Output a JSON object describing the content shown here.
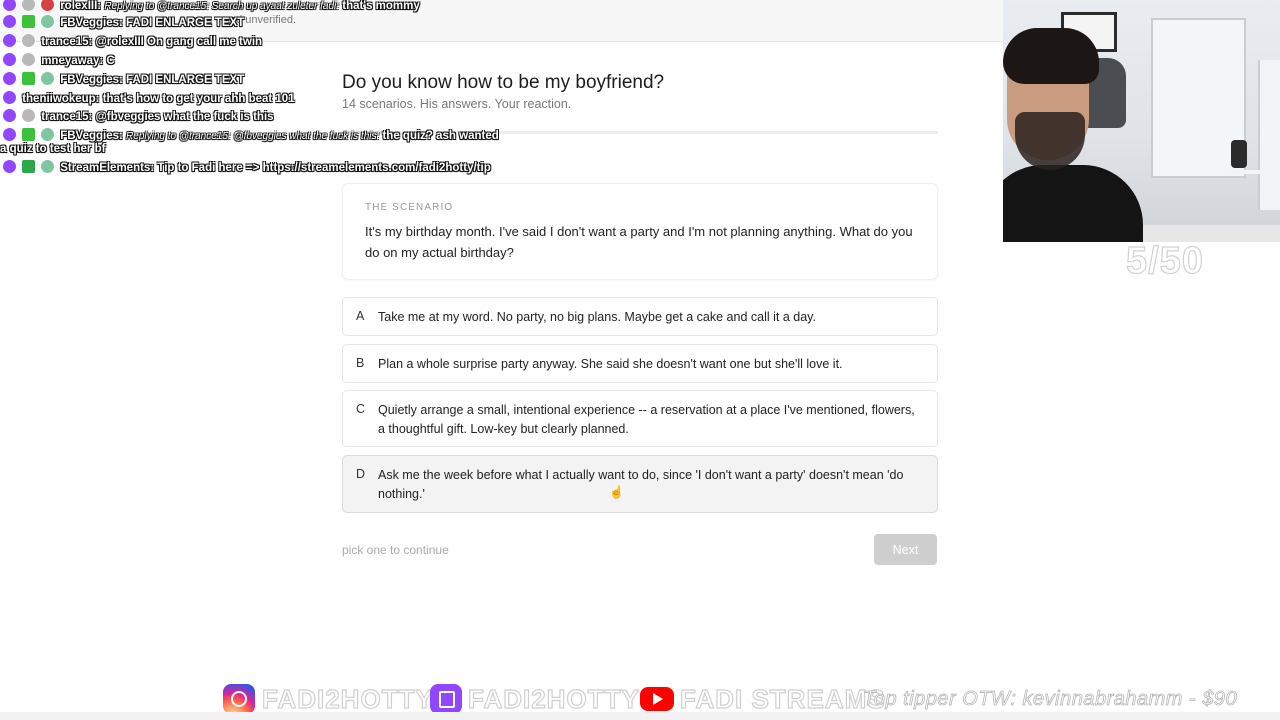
{
  "header": {
    "unverified_text": "nd unverified."
  },
  "quiz": {
    "title": "Do you know how to be my boyfriend?",
    "subtitle": "14 scenarios. His answers. Your reaction.",
    "progress": 0.07,
    "scenario_eyebrow": "THE SCENARIO",
    "scenario_text": "It's my birthday month. I've said I don't want a party and I'm not planning anything. What do you do on my actual birthday?",
    "options": [
      {
        "letter": "A",
        "text": "Take me at my word. No party, no big plans. Maybe get a cake and call it a day."
      },
      {
        "letter": "B",
        "text": "Plan a whole surprise party anyway. She said she doesn't want one but she'll love it."
      },
      {
        "letter": "C",
        "text": "Quietly arrange a small, intentional experience -- a reservation at a place I've mentioned, flowers, a thoughtful gift. Low-key but clearly planned."
      },
      {
        "letter": "D",
        "text": "Ask me the week before what I actually want to do, since 'I don't want a party' doesn't mean 'do nothing.'"
      }
    ],
    "hint": "pick one to continue",
    "next_label": "Next"
  },
  "stream": {
    "counter": "5/50",
    "chat": [
      {
        "user": "rolexIII:",
        "reply": "Replying to @trance15: Search up ayaat zuleter fadi:",
        "message": "that's mommy"
      },
      {
        "user": "FBVeggies:",
        "reply": "",
        "message": "FADI ENLARGE TEXT"
      },
      {
        "user": "trance15:",
        "reply": "",
        "message": "@rolexIII On gang call me twin"
      },
      {
        "user": "mneyaway:",
        "reply": "",
        "message": "C"
      },
      {
        "user": "FBVeggies:",
        "reply": "",
        "message": "FADI ENLARGE TEXT"
      },
      {
        "user": "theniiwokeup:",
        "reply": "",
        "message": "that's how to get your ahh beat 101"
      },
      {
        "user": "trance15:",
        "reply": "",
        "message": "@fbveggies what the fuck is this"
      },
      {
        "user": "FBVeggies:",
        "reply": "Replying to @trance15: @fbveggies what the fuck is this:",
        "message": "the quiz? ash wanted"
      },
      {
        "user": "",
        "reply": "",
        "message": "a quiz to test her bf"
      },
      {
        "user": "StreamElements:",
        "reply": "",
        "message": "Tip to Fadi here => https://streamelements.com/fadi2hotty/tip"
      }
    ],
    "banner": {
      "instagram": "FADI2HOTTY",
      "twitch": "FADI2HOTTY",
      "youtube": "FADI STREAMS",
      "tipper": "Top tipper OTW: kevinnabrahamm - $90"
    }
  }
}
